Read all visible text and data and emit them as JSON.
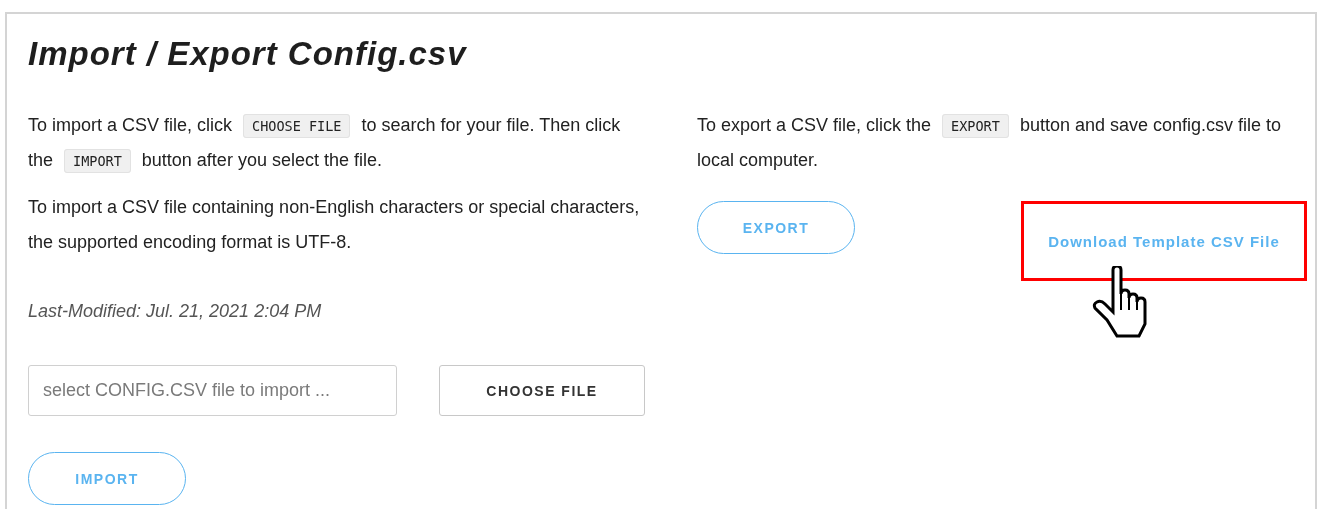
{
  "title": "Import / Export Config.csv",
  "import": {
    "paragraphs": [
      {
        "segments": [
          {
            "kind": "text",
            "text": "To import a CSV file, click"
          },
          {
            "kind": "code",
            "text": "CHOOSE FILE"
          },
          {
            "kind": "text",
            "text": "to search for your file. Then click the"
          },
          {
            "kind": "code",
            "text": "IMPORT"
          },
          {
            "kind": "text",
            "text": "button after you select the file."
          }
        ]
      },
      {
        "segments": [
          {
            "kind": "text",
            "text": "To import a CSV file containing non-English characters or special characters, the supported encoding format is UTF-8."
          }
        ]
      }
    ],
    "last_modified": "Last-Modified: Jul. 21, 2021 2:04 PM",
    "file_field": {
      "placeholder": "select CONFIG.CSV file to import ..."
    },
    "choose_button": "CHOOSE FILE",
    "import_button": "IMPORT"
  },
  "export": {
    "paragraphs": [
      {
        "segments": [
          {
            "kind": "text",
            "text": "To export a CSV file, click the"
          },
          {
            "kind": "code",
            "text": "EXPORT"
          },
          {
            "kind": "text",
            "text": "button and save config.csv file to local computer."
          }
        ]
      }
    ],
    "export_button": "EXPORT",
    "template_link": {
      "label": "Download Template CSV File",
      "highlighted": true
    }
  }
}
